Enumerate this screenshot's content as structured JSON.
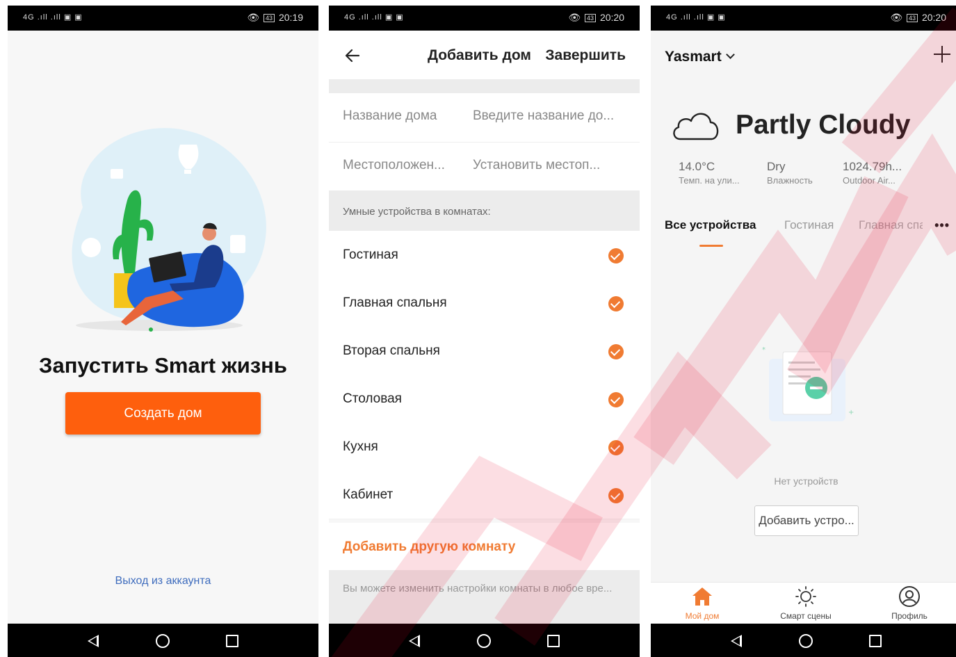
{
  "status_bars": [
    {
      "left": "4G .ıll .ıll ▣ ▣",
      "battery": "43",
      "time": "20:19"
    },
    {
      "left": "4G .ıll .ıll ▣ ▣",
      "battery": "43",
      "time": "20:20"
    },
    {
      "left": "4G .ıll .ıll ▣ ▣",
      "battery": "43",
      "time": "20:20"
    }
  ],
  "screen1": {
    "title": "Запустить Smart жизнь",
    "create_button": "Создать дом",
    "logout_link": "Выход из аккаунта"
  },
  "screen2": {
    "header_title": "Добавить дом",
    "done_button": "Завершить",
    "form": [
      {
        "label": "Название дома",
        "placeholder": "Введите название до..."
      },
      {
        "label": "Местоположен...",
        "placeholder": "Установить местоп..."
      }
    ],
    "rooms_section": "Умные устройства в комнатах:",
    "rooms": [
      "Гостиная",
      "Главная спальня",
      "Вторая спальня",
      "Столовая",
      "Кухня",
      "Кабинет"
    ],
    "add_room": "Добавить другую комнату",
    "hint": "Вы можете изменить настройки комнаты в любое вре..."
  },
  "screen3": {
    "home_name": "Yasmart",
    "weather": "Partly Cloudy",
    "stats": [
      {
        "value": "14.0°C",
        "label": "Темп. на ули..."
      },
      {
        "value": "Dry",
        "label": "Влажность"
      },
      {
        "value": "1024.79h...",
        "label": "Outdoor Air..."
      }
    ],
    "tabs": [
      "Все устройства",
      "Гостиная",
      "Главная спа"
    ],
    "more": "•••",
    "empty_text": "Нет устройств",
    "add_device_button": "Добавить устро...",
    "bottom_tabs": [
      {
        "label": "Мой дом",
        "icon": "home-icon"
      },
      {
        "label": "Смарт сцены",
        "icon": "sun-icon"
      },
      {
        "label": "Профиль",
        "icon": "profile-icon"
      }
    ]
  },
  "colors": {
    "accent": "#fe5f0d",
    "check": "#f07b32",
    "link": "#3e6cbd",
    "watermark": "#e8002a"
  }
}
